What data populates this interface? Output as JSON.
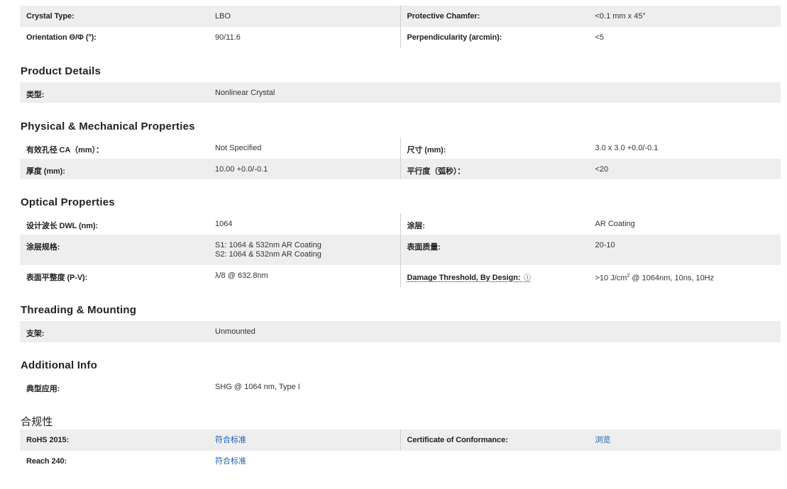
{
  "top_table": {
    "rows": [
      {
        "l_label": "Crystal Type:",
        "l_value": "LBO",
        "r_label": "Protective Chamfer:",
        "r_value": "<0.1 mm x 45°"
      },
      {
        "l_label": "Orientation Θ/Φ (°):",
        "l_value": "90/11.6",
        "r_label": "Perpendicularity (arcmin):",
        "r_value": "<5"
      }
    ]
  },
  "product_details": {
    "title": "Product Details",
    "rows": [
      {
        "l_label": "类型:",
        "l_value": "Nonlinear Crystal"
      }
    ]
  },
  "physical": {
    "title": "Physical & Mechanical Properties",
    "rows": [
      {
        "l_label": "有效孔径 CA（mm）：",
        "l_value": "Not Specified",
        "r_label": "尺寸 (mm):",
        "r_value": "3.0 x 3.0 +0.0/-0.1"
      },
      {
        "l_label": "厚度 (mm):",
        "l_value": "10.00 +0.0/-0.1",
        "r_label": "平行度（弧秒）：",
        "r_value": "<20"
      }
    ]
  },
  "optical": {
    "title": "Optical Properties",
    "rows": [
      {
        "l_label": "设计波长 DWL (nm):",
        "l_value": "1064",
        "r_label": "涂层:",
        "r_value": "AR Coating"
      },
      {
        "l_label": "涂层规格:",
        "l_value_1": "S1: 1064 & 532nm AR Coating",
        "l_value_2": "S2: 1064 & 532nm AR Coating",
        "r_label": "表面质量:",
        "r_value": "20-10"
      },
      {
        "l_label": "表面平整度 (P-V):",
        "l_value": "λ/8 @ 632.8nm",
        "r_label": "Damage Threshold, By Design:",
        "r_label_icon": "ⓘ",
        "r_value_pre": ">10 J/cm",
        "r_value_sup": "2",
        "r_value_post": " @ 1064nm, 10ns, 10Hz"
      }
    ]
  },
  "threading": {
    "title": "Threading & Mounting",
    "rows": [
      {
        "l_label": "支架:",
        "l_value": "Unmounted"
      }
    ]
  },
  "additional": {
    "title": "Additional Info",
    "rows": [
      {
        "l_label": "典型应用:",
        "l_value": "SHG @ 1064 nm, Type I"
      }
    ]
  },
  "compliance": {
    "title": "合规性",
    "rows": [
      {
        "l_label": "RoHS 2015:",
        "l_value": "符合标准",
        "r_label": "Certificate of Conformance:",
        "r_value": "浏览"
      },
      {
        "l_label": "Reach 240:",
        "l_value": "符合标准"
      }
    ]
  },
  "colors": {
    "row_shade": "#eeeeee",
    "link": "#1a5fb4",
    "divider": "#cfcfcf"
  }
}
